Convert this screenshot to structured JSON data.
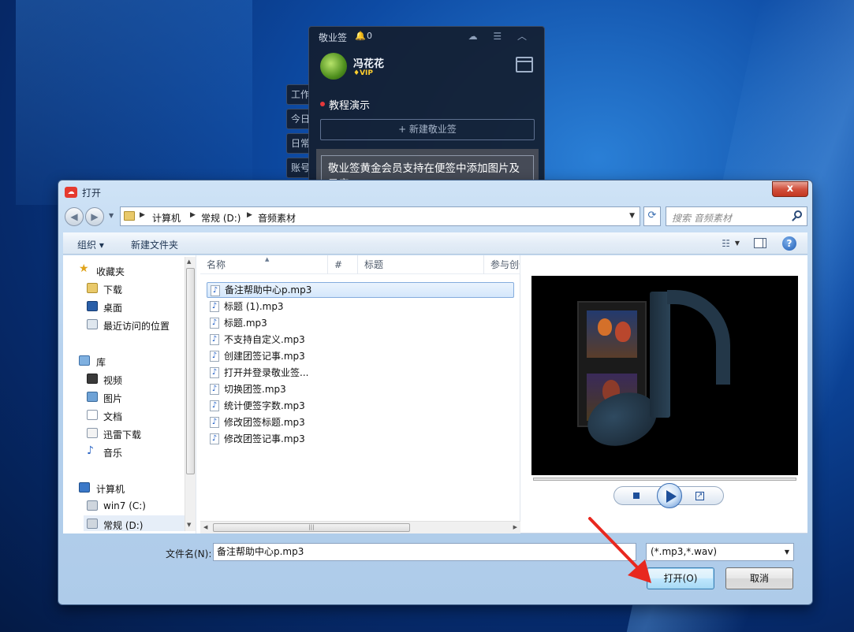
{
  "note_app": {
    "title": "敬业签",
    "bell_count": "0",
    "top_icons": "☁ ☰ ︿",
    "user_name": "冯花花",
    "vip_label": "♦VIP",
    "category": "教程演示",
    "new_button": "+ 新建敬业签",
    "card_text": "敬业签黄金会员支持在便签中添加图片及录音",
    "side_tabs": [
      "工作",
      "今日",
      "日常",
      "账号"
    ]
  },
  "dialog": {
    "title": "打开",
    "close_label": "x",
    "breadcrumb": [
      "计算机",
      "常规 (D:)",
      "音频素材"
    ],
    "search_placeholder": "搜索 音频素材",
    "toolbar": {
      "organize": "组织 ▾",
      "new_folder": "新建文件夹"
    },
    "nav": {
      "favorites": "收藏夹",
      "favorites_items": [
        "下载",
        "桌面",
        "最近访问的位置"
      ],
      "library": "库",
      "library_items": [
        "视频",
        "图片",
        "文档",
        "迅雷下载",
        "音乐"
      ],
      "computer": "计算机",
      "computer_items": [
        "win7 (C:)",
        "常规 (D:)"
      ]
    },
    "columns": [
      "名称",
      "#",
      "标题",
      "参与创作"
    ],
    "files": [
      "备注帮助中心p.mp3",
      "标题 (1).mp3",
      "标题.mp3",
      "不支持自定义.mp3",
      "创建团签记事.mp3",
      "打开并登录敬业签...",
      "切换团签.mp3",
      "统计便签字数.mp3",
      "修改团签标题.mp3",
      "修改团签记事.mp3"
    ],
    "selected_index": 0,
    "filename_label": "文件名(N):",
    "filename_value": "备注帮助中心p.mp3",
    "filetype_value": "(*.mp3,*.wav)",
    "open_button": "打开(O)",
    "cancel_button": "取消"
  },
  "colors": {
    "accent_red": "#e5383b",
    "vip_gold": "#ffcf2e",
    "annotation_arrow": "#e8281f"
  }
}
